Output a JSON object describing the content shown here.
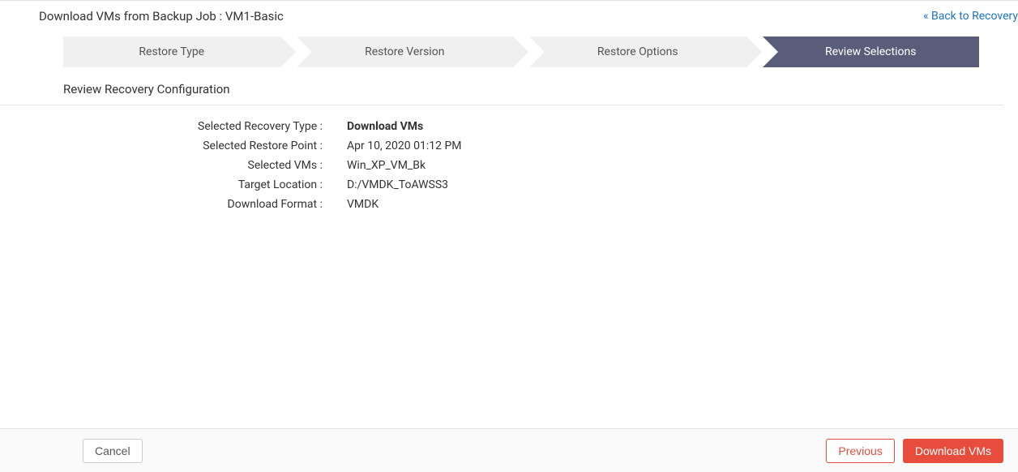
{
  "header": {
    "title": "Download VMs from Backup Job  : VM1-Basic",
    "back_link": "« Back to Recovery"
  },
  "wizard": {
    "steps": [
      {
        "label": "Restore Type",
        "active": false
      },
      {
        "label": "Restore Version",
        "active": false
      },
      {
        "label": "Restore Options",
        "active": false
      },
      {
        "label": "Review Selections",
        "active": true
      }
    ]
  },
  "section_title": "Review Recovery Configuration",
  "config": {
    "rows": [
      {
        "label": "Selected Recovery Type :",
        "value": "Download VMs",
        "bold": true
      },
      {
        "label": "Selected Restore Point :",
        "value": "Apr 10, 2020 01:12 PM",
        "bold": false
      },
      {
        "label": "Selected VMs :",
        "value": "Win_XP_VM_Bk",
        "bold": false
      },
      {
        "label": "Target Location :",
        "value": "D:/VMDK_ToAWSS3",
        "bold": false
      },
      {
        "label": "Download Format :",
        "value": "VMDK",
        "bold": false
      }
    ]
  },
  "footer": {
    "cancel": "Cancel",
    "previous": "Previous",
    "primary": "Download VMs"
  }
}
